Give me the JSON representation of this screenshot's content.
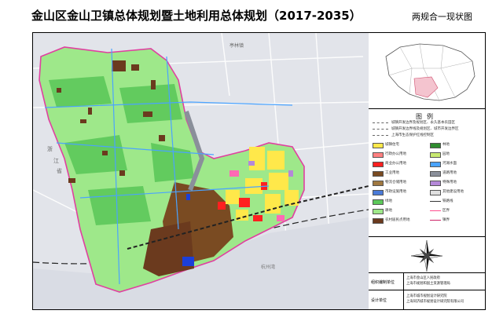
{
  "header": {
    "title": "金山区金山卫镇总体规划暨土地利用总体规划（2017-2035）",
    "subtitle": "两规合一现状图"
  },
  "map": {
    "labels": {
      "province": "浙",
      "province2": "江",
      "province3": "省",
      "place": "亭林镇",
      "coastal": "杭州湾"
    },
    "colors": {
      "farmland": "#9ee88a",
      "ecology": "#5cc85a",
      "village": "#6b3a1e",
      "urban_res": "#ffe84a",
      "industrial": "#7a4b22",
      "commercial": "#ff2020",
      "water": "#4aa3ff",
      "public": "#ff69b4",
      "purple": "#b488d8",
      "blue": "#1c3fd8",
      "road": "#8a8f9a",
      "background": "#e2e4ea"
    }
  },
  "legend": {
    "title": "图例",
    "line_rows": [
      "城镇开发边界及规划区、永久基本农田区",
      "城镇开发边界线及规划区、城市开发边界区",
      "上海市生态保护红线控制区"
    ],
    "items_left": [
      {
        "label": "城镇住宅",
        "color": "#ffe84a"
      },
      {
        "label": "行政办公用地",
        "color": "#ff8080"
      },
      {
        "label": "商业办公用地",
        "color": "#ff2020"
      },
      {
        "label": "工业用地",
        "color": "#7a4b22"
      },
      {
        "label": "物流仓储用地",
        "color": "#a07840"
      },
      {
        "label": "市政设施用地",
        "color": "#4a7ad8"
      },
      {
        "label": "绿地",
        "color": "#5cc85a"
      },
      {
        "label": "耕地",
        "color": "#9ee88a"
      },
      {
        "label": "农村居民点用地",
        "color": "#6b3a1e"
      }
    ],
    "items_right": [
      {
        "label": "林地",
        "color": "#2e8b2e"
      },
      {
        "label": "园地",
        "color": "#c8e870"
      },
      {
        "label": "河湖水面",
        "color": "#4aa3ff"
      },
      {
        "label": "道路用地",
        "color": "#8a8f9a"
      },
      {
        "label": "特殊用地",
        "color": "#b488d8"
      },
      {
        "label": "其他建设用地",
        "color": "#e0e0e0"
      },
      {
        "label": "铁路线",
        "color": "#333333"
      },
      {
        "label": "区界",
        "color": "#ff4d8f"
      },
      {
        "label": "镇界",
        "color": "#cc2266"
      }
    ]
  },
  "info": {
    "row1_label": "组织编制单位",
    "row1_value_a": "上海市金山区人民政府",
    "row1_value_b": "上海市规划和国土资源管理局",
    "row2_label": "设计单位",
    "row2_value_a": "上海市城市规划设计研究院",
    "row2_value_b": "上海同济城市规划设计研究院有限公司"
  }
}
